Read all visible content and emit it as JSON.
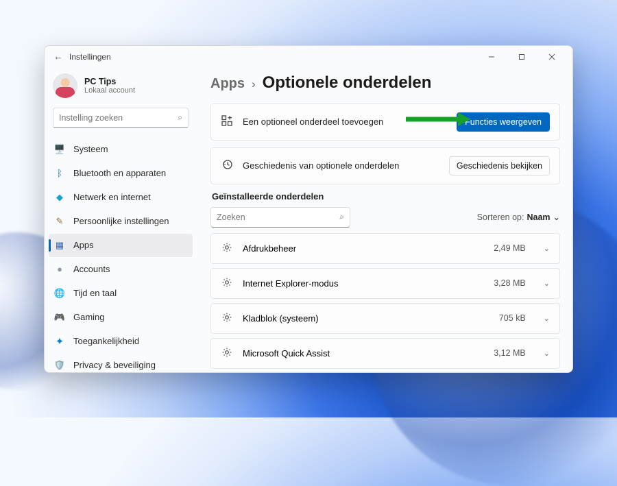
{
  "window": {
    "title": "Instellingen"
  },
  "profile": {
    "name": "PC Tips",
    "sub": "Lokaal account"
  },
  "sidebar_search_placeholder": "Instelling zoeken",
  "nav": [
    {
      "icon": "🖥️",
      "label": "Systeem"
    },
    {
      "icon": "ᛒ",
      "label": "Bluetooth en apparaten",
      "iconColor": "#0067c0"
    },
    {
      "icon": "◆",
      "label": "Netwerk en internet",
      "iconColor": "#1aa2cf"
    },
    {
      "icon": "✎",
      "label": "Persoonlijke instellingen",
      "iconColor": "#93714a"
    },
    {
      "icon": "▦",
      "label": "Apps",
      "active": true,
      "iconColor": "#3b6ab5"
    },
    {
      "icon": "●",
      "label": "Accounts",
      "iconColor": "#8f9aa6"
    },
    {
      "icon": "🌐",
      "label": "Tijd en taal"
    },
    {
      "icon": "🎮",
      "label": "Gaming"
    },
    {
      "icon": "✦",
      "label": "Toegankelijkheid",
      "iconColor": "#0a7bd1",
      "iconFont": "15px"
    },
    {
      "icon": "🛡️",
      "label": "Privacy & beveiliging"
    }
  ],
  "crumb": {
    "parent": "Apps",
    "sep": "›",
    "page": "Optionele onderdelen"
  },
  "card_add": {
    "label": "Een optioneel onderdeel toevoegen",
    "button": "Functies weergeven"
  },
  "card_history": {
    "label": "Geschiedenis van optionele onderdelen",
    "button": "Geschiedenis bekijken"
  },
  "installed_heading": "Geïnstalleerde onderdelen",
  "installed_search_placeholder": "Zoeken",
  "sort": {
    "label": "Sorteren op:",
    "value": "Naam"
  },
  "items": [
    {
      "name": "Afdrukbeheer",
      "size": "2,49 MB"
    },
    {
      "name": "Internet Explorer-modus",
      "size": "3,28 MB"
    },
    {
      "name": "Kladblok (systeem)",
      "size": "705 kB"
    },
    {
      "name": "Microsoft Quick Assist",
      "size": "3,12 MB"
    }
  ]
}
